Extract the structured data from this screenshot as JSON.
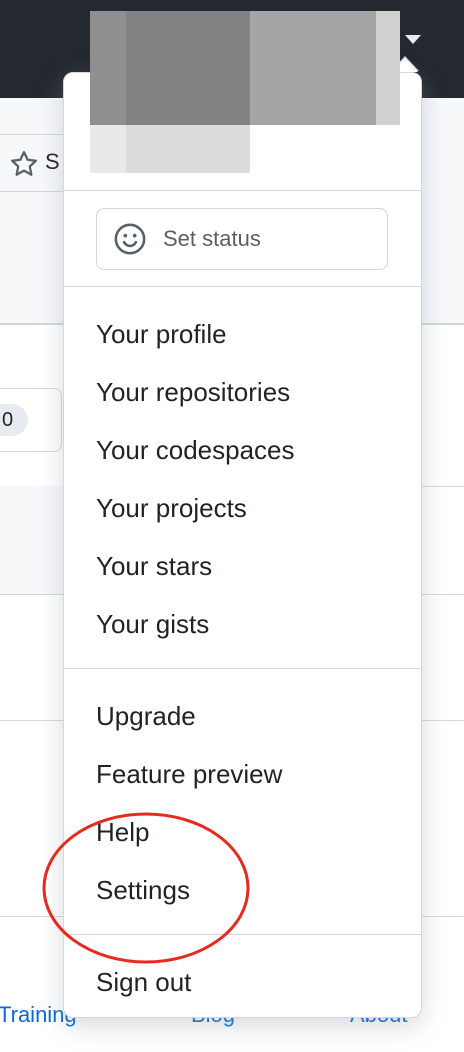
{
  "background": {
    "star_label_partial": "S",
    "watch_count_partial": "0",
    "footer_links": [
      "Training",
      "Blog",
      "About"
    ]
  },
  "dropdown": {
    "set_status": {
      "icon": "smiley-icon",
      "label": "Set status"
    },
    "section_profile": [
      "Your profile",
      "Your repositories",
      "Your codespaces",
      "Your projects",
      "Your stars",
      "Your gists"
    ],
    "section_account": [
      "Upgrade",
      "Feature preview",
      "Help",
      "Settings"
    ],
    "sign_out": "Sign out"
  },
  "annotation": {
    "shape": "ellipse",
    "color": "#e8291c",
    "highlights": "Settings"
  },
  "colors": {
    "header_bg": "#24292f",
    "text": "#1f2328",
    "muted_text": "#57606a",
    "border": "#d0d7de",
    "link": "#0969da"
  }
}
